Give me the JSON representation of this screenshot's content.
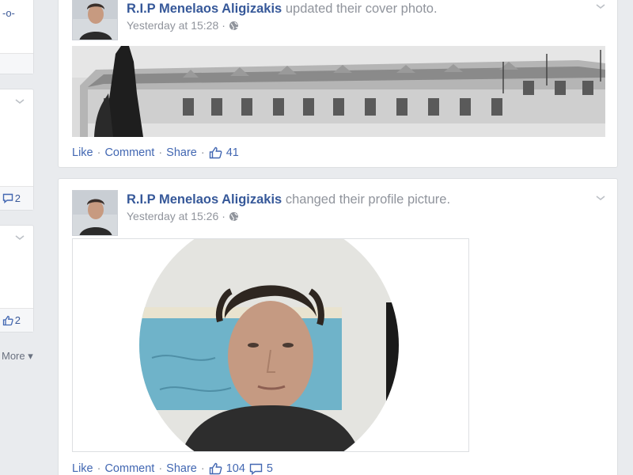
{
  "sidebar": {
    "card1_fragment": "-o-",
    "card2_like_count": "2",
    "card3_like_count": "2",
    "more_label": "More"
  },
  "posts": [
    {
      "author": "R.I.P Menelaos Aligizakis",
      "action": "updated their cover photo.",
      "timestamp": "Yesterday at 15:28",
      "like_label": "Like",
      "comment_label": "Comment",
      "share_label": "Share",
      "like_count": "41"
    },
    {
      "author": "R.I.P Menelaos Aligizakis",
      "action": "changed their profile picture.",
      "timestamp": "Yesterday at 15:26",
      "like_label": "Like",
      "comment_label": "Comment",
      "share_label": "Share",
      "like_count": "104",
      "comment_count": "5"
    }
  ],
  "icons": {
    "globe": "globe-icon",
    "like": "thumbs-up-icon",
    "comment": "comment-icon",
    "chevron": "chevron-down-icon"
  },
  "colors": {
    "link": "#365899",
    "background": "#e9ebee",
    "muted": "#90949c"
  }
}
